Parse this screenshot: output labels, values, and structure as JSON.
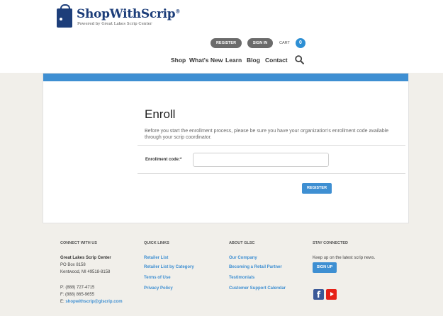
{
  "brand": {
    "name": "ShopWithScrip",
    "reg_mark": "®",
    "tagline": "Powered by Great Lakes Scrip Center"
  },
  "account": {
    "register_label": "REGISTER",
    "signin_label": "SIGN IN",
    "cart_label": "CART",
    "cart_count": "0"
  },
  "nav": {
    "items": [
      "Shop",
      "What's New",
      "Learn",
      "Blog",
      "Contact"
    ]
  },
  "enroll": {
    "title": "Enroll",
    "description": "Before you start the enrollment process, please be sure you have your organization's enrollment code available through your scrip coordinator.",
    "code_label": "Enrollment code:*",
    "code_value": "",
    "register_button": "REGISTER"
  },
  "footer": {
    "connect": {
      "heading": "CONNECT WITH US",
      "org": "Great Lakes Scrip Center",
      "address1": "PO Box 8158",
      "address2": "Kentwood, MI 49518-8158",
      "phone": "P: (888) 727-4715",
      "fax": "F: (888) 865-9655",
      "email_prefix": "E: ",
      "email": "shopwithscrip@glscrip.com"
    },
    "quick_links": {
      "heading": "QUICK LINKS",
      "items": [
        "Retailer List",
        "Retailer List by Category",
        "Terms of Use",
        "Privacy Policy"
      ]
    },
    "about": {
      "heading": "ABOUT GLSC",
      "items": [
        "Our Company",
        "Becoming a Retail Partner",
        "Testimonials",
        "Customer Support Calendar"
      ]
    },
    "stay_connected": {
      "heading": "STAY CONNECTED",
      "text": "Keep up on the latest scrip news.",
      "signup_label": "SIGN UP",
      "facebook_glyph": "f"
    }
  },
  "colors": {
    "brand_blue": "#1d3e7a",
    "accent_blue": "#3e8fd2",
    "band_bg": "#f1efea"
  },
  "icons": {
    "logo": "shopping-bag-icon",
    "search": "search-icon",
    "facebook": "facebook-icon",
    "youtube": "youtube-icon"
  }
}
